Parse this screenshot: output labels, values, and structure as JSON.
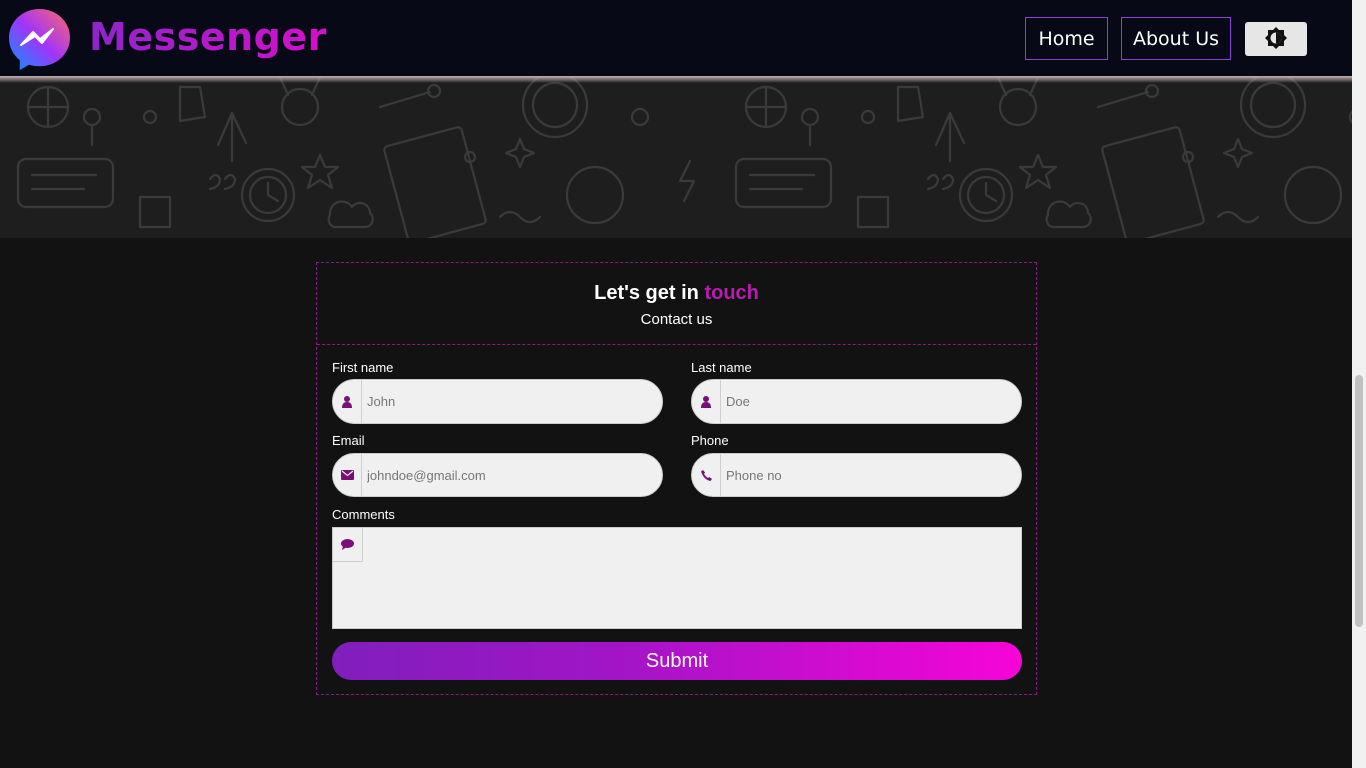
{
  "navbar": {
    "brand": "Messenger",
    "home_label": "Home",
    "about_label": "About Us",
    "logo_icon": "messenger-logo-icon",
    "theme_icon": "brightness-icon"
  },
  "contact": {
    "title_prefix": "Let's get in ",
    "title_accent": "touch",
    "subtitle": "Contact us",
    "fields": {
      "first_name": {
        "label": "First name",
        "placeholder": "John",
        "icon": "user-icon"
      },
      "last_name": {
        "label": "Last name",
        "placeholder": "Doe",
        "icon": "user-icon"
      },
      "email": {
        "label": "Email",
        "placeholder": "johndoe@gmail.com",
        "icon": "envelope-icon"
      },
      "phone": {
        "label": "Phone",
        "placeholder": "Phone no",
        "icon": "phone-icon"
      },
      "comments": {
        "label": "Comments",
        "icon": "comment-icon"
      }
    },
    "submit_label": "Submit"
  },
  "colors": {
    "accent": "#b81cb0",
    "icon": "#7a0f7a",
    "navbar_bg": "#070a16",
    "page_bg": "#121212",
    "submit_gradient_start": "#7f1fbc",
    "submit_gradient_end": "#f704d8"
  }
}
